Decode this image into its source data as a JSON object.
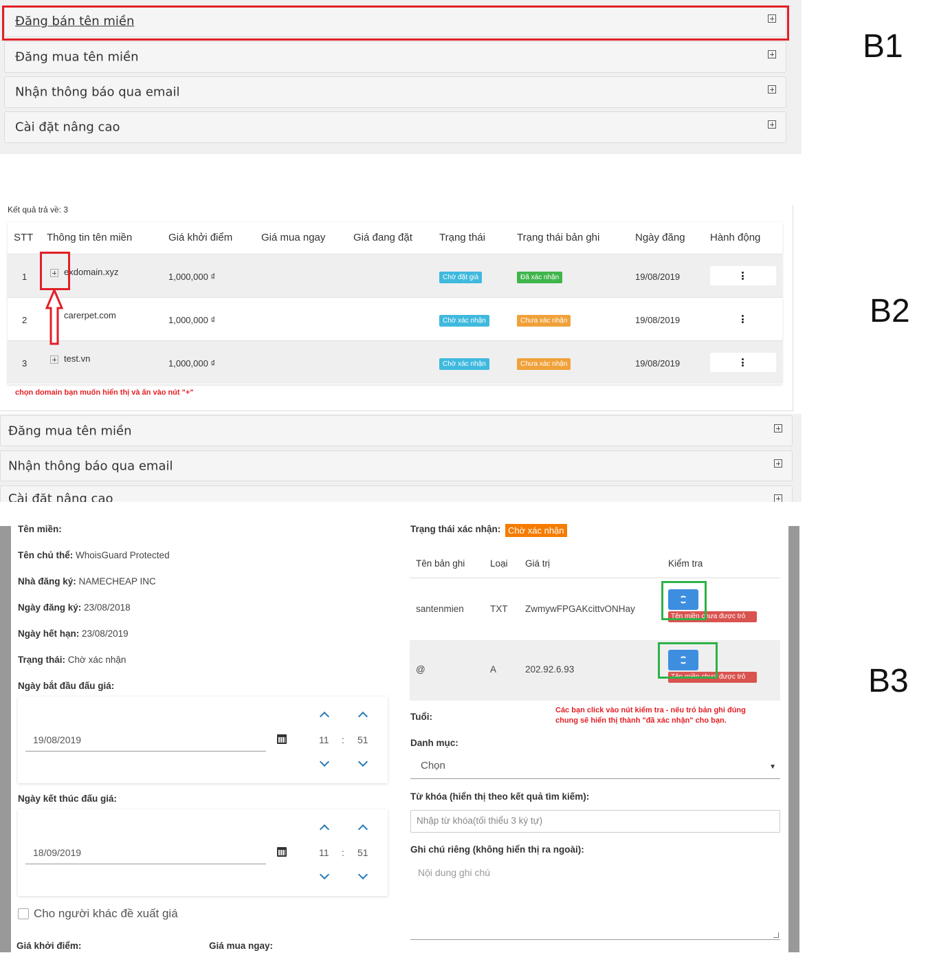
{
  "steps": {
    "b1": "B1",
    "b2": "B2",
    "b3": "B3"
  },
  "accordion": {
    "sell": "Đăng bán tên miền",
    "buy": "Đăng mua tên miền",
    "email": "Nhận thông báo qua email",
    "advanced": "Cài đặt nâng cao"
  },
  "b2": {
    "result_count": "Kết quả trả về: 3",
    "headers": [
      "STT",
      "Thông tin tên miền",
      "Giá khởi điểm",
      "Giá mua ngay",
      "Giá đang đặt",
      "Trạng thái",
      "Trạng thái bản ghi",
      "Ngày đăng",
      "Hành động"
    ],
    "rows": [
      {
        "stt": "1",
        "domain": "exdomain.xyz",
        "price": "1,000,000 ₫",
        "status": "Chờ đặt giá",
        "record_status": "Đã xác nhận",
        "date": "19/08/2019"
      },
      {
        "stt": "2",
        "domain": "carerpet.com",
        "price": "1,000,000 ₫",
        "status": "Chờ xác nhận",
        "record_status": "Chưa xác nhận",
        "date": "19/08/2019"
      },
      {
        "stt": "3",
        "domain": "test.vn",
        "price": "1,000,000 ₫",
        "status": "Chờ xác nhận",
        "record_status": "Chưa xác nhận",
        "date": "19/08/2019"
      }
    ],
    "hint": "chọn domain bạn muốn hiển thị và ấn vào nút \"+\"",
    "colors": {
      "blue": "#40b9de",
      "green": "#3fb54c",
      "orange": "#f0a13a",
      "red": "#e21f26"
    }
  },
  "b3": {
    "fields": {
      "domain_label": "Tên miền:",
      "owner_label": "Tên chủ thể:",
      "owner_value": "WhoisGuard Protected",
      "registrar_label": "Nhà đăng ký:",
      "registrar_value": "NAMECHEAP INC",
      "reg_date_label": "Ngày đăng ký:",
      "reg_date_value": "23/08/2018",
      "exp_date_label": "Ngày hết hạn:",
      "exp_date_value": "23/08/2019",
      "status_label": "Trạng thái:",
      "status_value": "Chờ xác nhận"
    },
    "start": {
      "label": "Ngày bắt đầu đấu giá:",
      "date": "19/08/2019",
      "hour": "11",
      "minute": "51"
    },
    "end": {
      "label": "Ngày kết thúc đấu giá:",
      "date": "18/09/2019",
      "hour": "11",
      "minute": "51"
    },
    "time_sep": ":",
    "allow_offer": "Cho người khác đề xuất giá",
    "start_price_label": "Giá khởi điểm:",
    "buy_now_label": "Giá mua ngay:",
    "verify_label": "Trạng thái xác nhận:",
    "verify_value": "Chờ xác nhận",
    "record_headers": [
      "Tên bản ghi",
      "Loại",
      "Giá trị",
      "Kiểm tra"
    ],
    "records": [
      {
        "name": "santenmien",
        "type": "TXT",
        "value": "ZwmywFPGAKcittvONHay",
        "check_tag": "Tên miền chưa được trỏ"
      },
      {
        "name": "@",
        "type": "A",
        "value": "202.92.6.93",
        "check_tag": "Tên miền chưa được trỏ"
      }
    ],
    "hint": "Các bạn click vào nút kiểm tra - nếu trỏ bản ghi đúng chung sẽ hiển thị thành \"đã xác nhận\" cho bạn.",
    "age_label": "Tuổi:",
    "category_label": "Danh mục:",
    "category_value": "Chọn",
    "keyword_label": "Từ khóa (hiển thị theo kết quả tìm kiếm):",
    "keyword_placeholder": "Nhập từ khóa(tối thiểu 3 ký tự)",
    "note_label": "Ghi chú riêng (không hiển thị ra ngoài):",
    "note_placeholder": "Nội dung ghi chú",
    "colors": {
      "sync_button": "#3e8ee0",
      "highlight": "#2db247",
      "verify_badge": "#f57c00"
    }
  }
}
